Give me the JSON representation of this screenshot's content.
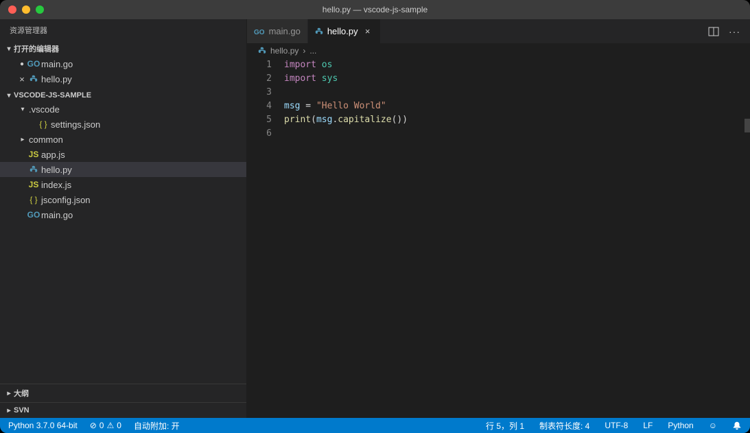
{
  "titlebar": {
    "title": "hello.py — vscode-js-sample"
  },
  "sidebar": {
    "header": "资源管理器",
    "open_editors_title": "打开的编辑器",
    "open_editors": [
      {
        "label": "main.go",
        "icon": "go",
        "modified": false
      },
      {
        "label": "hello.py",
        "icon": "py",
        "modified": true
      }
    ],
    "project_title": "VSCODE-JS-SAMPLE",
    "tree": [
      {
        "label": ".vscode",
        "type": "folder",
        "expanded": true,
        "depth": 0
      },
      {
        "label": "settings.json",
        "type": "json",
        "depth": 1
      },
      {
        "label": "common",
        "type": "folder",
        "expanded": false,
        "depth": 0
      },
      {
        "label": "app.js",
        "type": "js",
        "depth": 0
      },
      {
        "label": "hello.py",
        "type": "py",
        "depth": 0,
        "active": true
      },
      {
        "label": "index.js",
        "type": "js",
        "depth": 0
      },
      {
        "label": "jsconfig.json",
        "type": "json",
        "depth": 0
      },
      {
        "label": "main.go",
        "type": "go",
        "depth": 0
      }
    ],
    "outline_title": "大纲",
    "svn_title": "SVN"
  },
  "tabs": [
    {
      "label": "main.go",
      "icon": "go",
      "active": false
    },
    {
      "label": "hello.py",
      "icon": "py",
      "active": true
    }
  ],
  "breadcrumb": {
    "file": "hello.py",
    "more": "..."
  },
  "editor": {
    "lines": [
      {
        "num": "1",
        "tokens": [
          [
            "kw",
            "import"
          ],
          [
            "",
            " "
          ],
          [
            "mod",
            "os"
          ]
        ]
      },
      {
        "num": "2",
        "tokens": [
          [
            "kw",
            "import"
          ],
          [
            "",
            " "
          ],
          [
            "mod",
            "sys"
          ]
        ]
      },
      {
        "num": "3",
        "tokens": []
      },
      {
        "num": "4",
        "tokens": [
          [
            "var",
            "msg"
          ],
          [
            "",
            " = "
          ],
          [
            "str",
            "\"Hello World\""
          ]
        ]
      },
      {
        "num": "5",
        "tokens": [
          [
            "fn",
            "print"
          ],
          [
            "",
            "("
          ],
          [
            "var",
            "msg"
          ],
          [
            "",
            "."
          ],
          [
            "fn",
            "capitalize"
          ],
          [
            "",
            "())"
          ]
        ]
      },
      {
        "num": "6",
        "tokens": []
      }
    ]
  },
  "statusbar": {
    "python": "Python 3.7.0 64-bit",
    "errors": "0",
    "warnings": "0",
    "attach": "自动附加: 开",
    "cursor": "行 5，列 1",
    "tabsize": "制表符长度: 4",
    "encoding": "UTF-8",
    "eol": "LF",
    "language": "Python"
  }
}
